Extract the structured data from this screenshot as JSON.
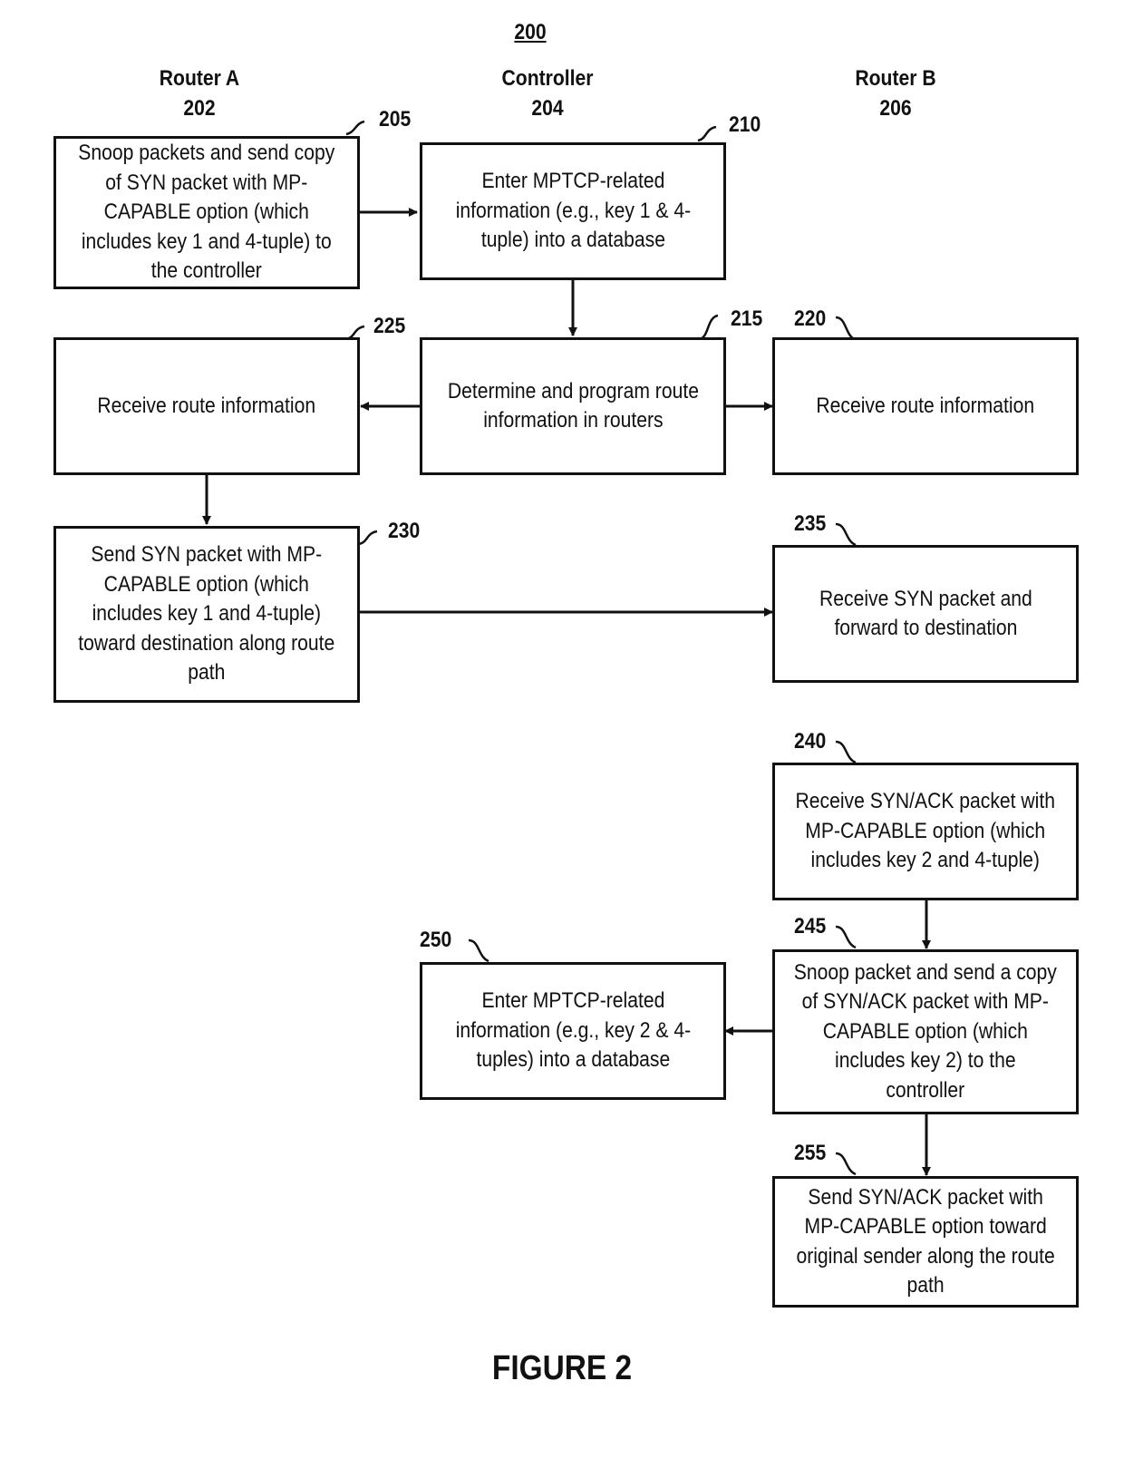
{
  "figure": {
    "number": "200",
    "caption": "FIGURE 2"
  },
  "columns": [
    {
      "name": "Router A",
      "ref": "202"
    },
    {
      "name": "Controller",
      "ref": "204"
    },
    {
      "name": "Router B",
      "ref": "206"
    }
  ],
  "steps": {
    "s205": {
      "ref": "205",
      "text": "Snoop packets and send copy\nof SYN packet with MP-\nCAPABLE option (which\nincludes key 1 and 4-tuple) to\nthe controller"
    },
    "s210": {
      "ref": "210",
      "text": "Enter MPTCP-related\ninformation (e.g., key  1 & 4-\ntuple) into a database"
    },
    "s215": {
      "ref": "215",
      "text": "Determine and program route\ninformation in routers"
    },
    "s220": {
      "ref": "220",
      "text": "Receive route information"
    },
    "s225": {
      "ref": "225",
      "text": "Receive route information"
    },
    "s230": {
      "ref": "230",
      "text": "Send SYN packet with MP-\nCAPABLE option (which\nincludes key 1 and 4-tuple)\ntoward destination along route\npath"
    },
    "s235": {
      "ref": "235",
      "text": "Receive SYN packet and\nforward to destination"
    },
    "s240": {
      "ref": "240",
      "text": "Receive SYN/ACK packet with\nMP-CAPABLE option (which\nincludes key 2 and 4-tuple)"
    },
    "s245": {
      "ref": "245",
      "text": "Snoop packet and send a copy\nof SYN/ACK packet with MP-\nCAPABLE option (which\nincludes key 2) to the\ncontroller"
    },
    "s250": {
      "ref": "250",
      "text": "Enter MPTCP-related\ninformation (e.g., key 2 & 4-\ntuples) into a database"
    },
    "s255": {
      "ref": "255",
      "text": "Send SYN/ACK packet with\nMP-CAPABLE option toward\noriginal sender along the route\npath"
    }
  },
  "flows": [
    {
      "from": "205",
      "to": "210"
    },
    {
      "from": "210",
      "to": "215"
    },
    {
      "from": "215",
      "to": "225"
    },
    {
      "from": "215",
      "to": "220"
    },
    {
      "from": "225",
      "to": "230"
    },
    {
      "from": "230",
      "to": "235"
    },
    {
      "from": "240",
      "to": "245"
    },
    {
      "from": "245",
      "to": "250"
    },
    {
      "from": "245",
      "to": "255"
    }
  ]
}
